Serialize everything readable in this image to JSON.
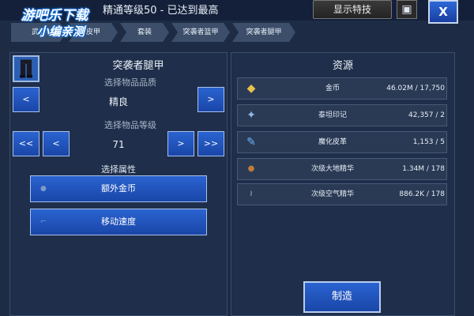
{
  "watermark": {
    "line1": "游吧乐下载",
    "line2": "小编亲测"
  },
  "header": {
    "title": "精通等级50 - 已达到最高",
    "show_skills_label": "显示特技",
    "chest_icon": "chest-icon",
    "close_label": "X"
  },
  "breadcrumb": [
    {
      "label": "武器"
    },
    {
      "label": "皮甲"
    },
    {
      "label": "套装"
    },
    {
      "label": "突袭者篮甲"
    },
    {
      "label": "突袭者腿甲"
    }
  ],
  "item": {
    "name": "突袭者腿甲",
    "icon": "leg-armor-icon"
  },
  "quality": {
    "label": "选择物品品质",
    "value": "精良",
    "prev": "<",
    "next": ">"
  },
  "level": {
    "label": "选择物品等级",
    "value": "71",
    "first": "<<",
    "prev": "<",
    "next": ">",
    "last": ">>"
  },
  "attributes": {
    "label": "选择属性",
    "options": [
      {
        "label": "额外金币",
        "icon": "coin-bag-icon"
      },
      {
        "label": "移动速度",
        "icon": "boot-icon"
      }
    ]
  },
  "resources": {
    "title": "资源",
    "rows": [
      {
        "name": "金币",
        "value": "46.02M / 17,750",
        "icon": "gold-coins-icon"
      },
      {
        "name": "泰坦印记",
        "value": "42,357 / 2",
        "icon": "titan-seal-icon"
      },
      {
        "name": "魔化皮革",
        "value": "1,153 / 5",
        "icon": "leather-scroll-icon"
      },
      {
        "name": "次级大地精华",
        "value": "1.34M / 178",
        "icon": "earth-essence-icon"
      },
      {
        "name": "次级空气精华",
        "value": "886.2K / 178",
        "icon": "air-essence-icon"
      }
    ]
  },
  "craft_label": "制造"
}
